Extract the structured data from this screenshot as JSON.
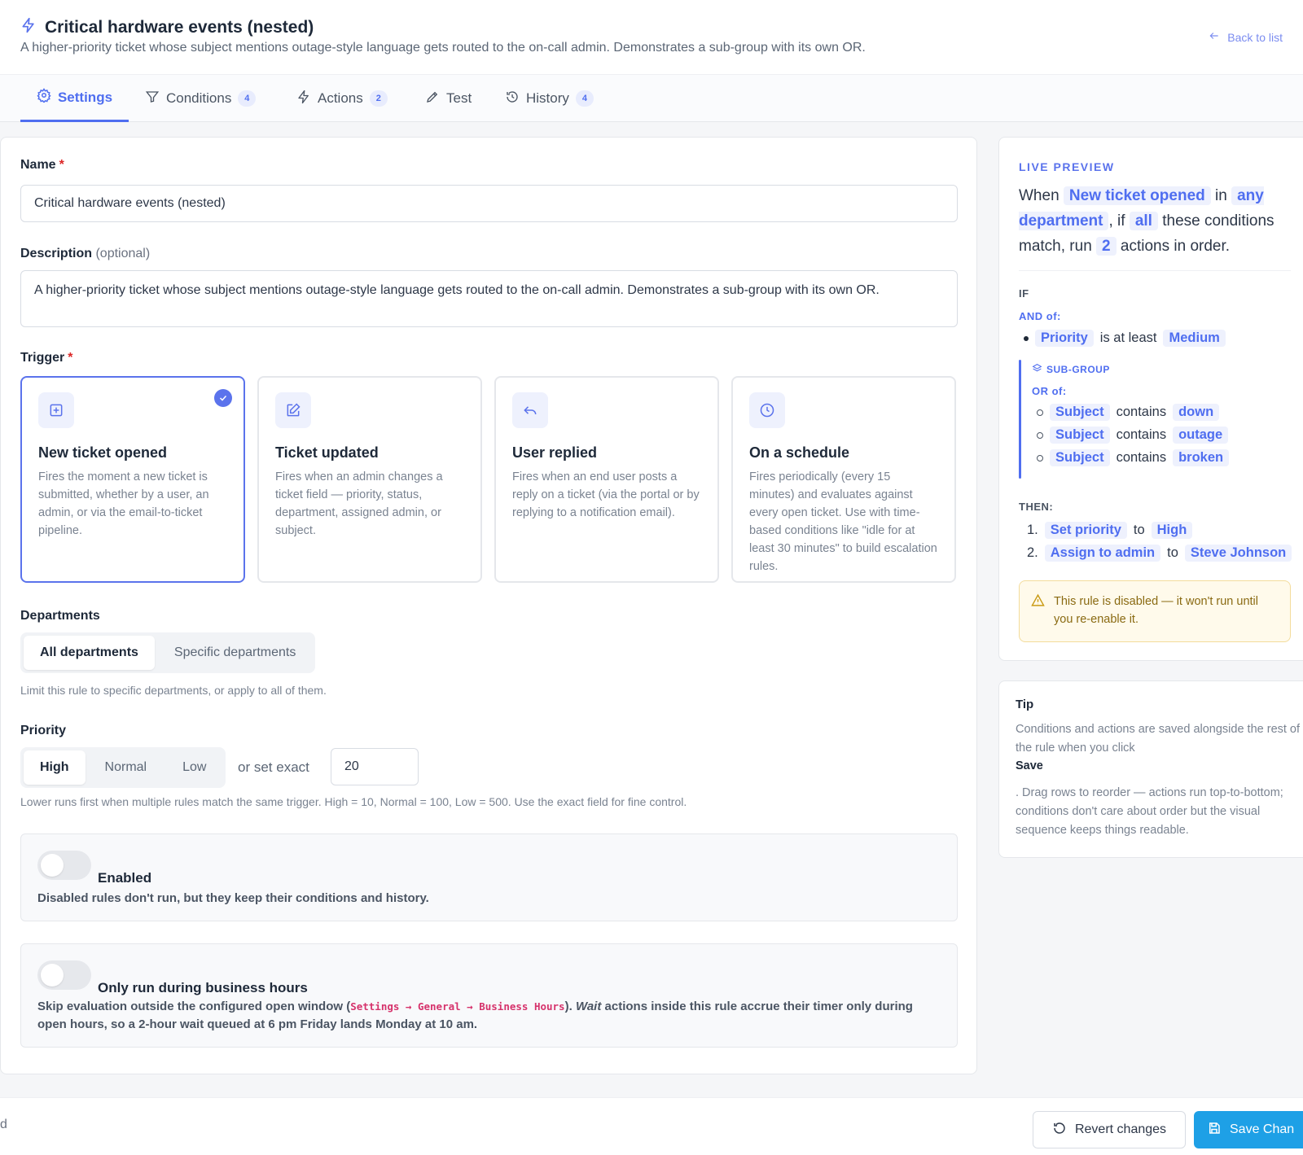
{
  "header": {
    "title": "Critical hardware events (nested)",
    "subtitle": "A higher-priority ticket whose subject mentions outage-style language gets routed to the on-call admin. Demonstrates a sub-group with its own OR.",
    "back_label": "Back to list"
  },
  "tabs": [
    {
      "label": "Settings",
      "badge": ""
    },
    {
      "label": "Conditions",
      "badge": "4"
    },
    {
      "label": "Actions",
      "badge": "2"
    },
    {
      "label": "Test",
      "badge": ""
    },
    {
      "label": "History",
      "badge": "4"
    }
  ],
  "form": {
    "name_label": "Name",
    "name_value": "Critical hardware events (nested)",
    "description_label": "Description",
    "description_optional": "(optional)",
    "description_value": "A higher-priority ticket whose subject mentions outage-style language gets routed to the on-call admin. Demonstrates a sub-group with its own OR.",
    "trigger_label": "Trigger",
    "required_mark": "*",
    "triggers": [
      {
        "title": "New ticket opened",
        "desc": "Fires the moment a new ticket is submitted, whether by a user, an admin, or via the email-to-ticket pipeline.",
        "icon": "plus-square-icon",
        "selected": true
      },
      {
        "title": "Ticket updated",
        "desc": "Fires when an admin changes a ticket field — priority, status, department, assigned admin, or subject.",
        "icon": "edit-icon",
        "selected": false
      },
      {
        "title": "User replied",
        "desc": "Fires when an end user posts a reply on a ticket (via the portal or by replying to a notification email).",
        "icon": "reply-icon",
        "selected": false
      },
      {
        "title": "On a schedule",
        "desc": "Fires periodically (every 15 minutes) and evaluates against every open ticket. Use with time-based conditions like \"idle for at least 30 minutes\" to build escalation rules.",
        "icon": "clock-icon",
        "selected": false
      }
    ],
    "departments_label": "Departments",
    "departments_options": [
      "All departments",
      "Specific departments"
    ],
    "departments_help": "Limit this rule to specific departments, or apply to all of them.",
    "priority_label": "Priority",
    "priority_options": [
      "High",
      "Normal",
      "Low"
    ],
    "priority_exact_label": "or set exact",
    "priority_exact_value": "20",
    "priority_help": "Lower runs first when multiple rules match the same trigger. High = 10, Normal = 100, Low = 500. Use the exact field for fine control.",
    "enabled_title": "Enabled",
    "enabled_desc": "Disabled rules don't run, but they keep their conditions and history.",
    "business_title": "Only run during business hours",
    "business_desc_1": "Skip evaluation outside the configured open window (",
    "business_code": "Settings → General → Business Hours",
    "business_desc_2": ").",
    "business_wait": "Wait",
    "business_desc_3": "actions inside this rule accrue their timer only during open hours, so a 2-hour wait queued at 6 pm Friday lands Monday at 10 am."
  },
  "preview": {
    "heading": "LIVE PREVIEW",
    "when": "When",
    "trigger_chip": "New ticket opened",
    "in": "in",
    "dept_chip": "any department",
    "if": ", if",
    "all_chip": "all",
    "these": "these conditions match, run",
    "count_chip": "2",
    "actions_in_order": "actions in order.",
    "if_label": "IF",
    "and_label": "AND of:",
    "cond1": {
      "field": "Priority",
      "op": "is at least",
      "value": "Medium"
    },
    "subgroup_label": "SUB-GROUP",
    "or_label": "OR of:",
    "or_conditions": [
      {
        "field": "Subject",
        "op": "contains",
        "value": "down"
      },
      {
        "field": "Subject",
        "op": "contains",
        "value": "outage"
      },
      {
        "field": "Subject",
        "op": "contains",
        "value": "broken"
      }
    ],
    "then_label": "THEN:",
    "actions": [
      {
        "num": "1.",
        "action": "Set priority",
        "to": "to",
        "value": "High"
      },
      {
        "num": "2.",
        "action": "Assign to admin",
        "to": "to",
        "value": "Steve Johnson"
      }
    ],
    "warning": "This rule is disabled — it won't run until you re-enable it."
  },
  "tip": {
    "heading": "Tip",
    "text1": "Conditions and actions are saved alongside the rest of the rule when you click",
    "bold": "Save",
    "text2": ". Drag rows to reorder — actions run top-to-bottom; conditions don't care about order but the visual sequence keeps things readable."
  },
  "footer": {
    "left_text": "d",
    "revert_label": "Revert changes",
    "save_label": "Save Chan"
  },
  "colors": {
    "accent": "#4f6ef0",
    "save": "#1ea0e6",
    "warning_bg": "#fffaeb"
  }
}
